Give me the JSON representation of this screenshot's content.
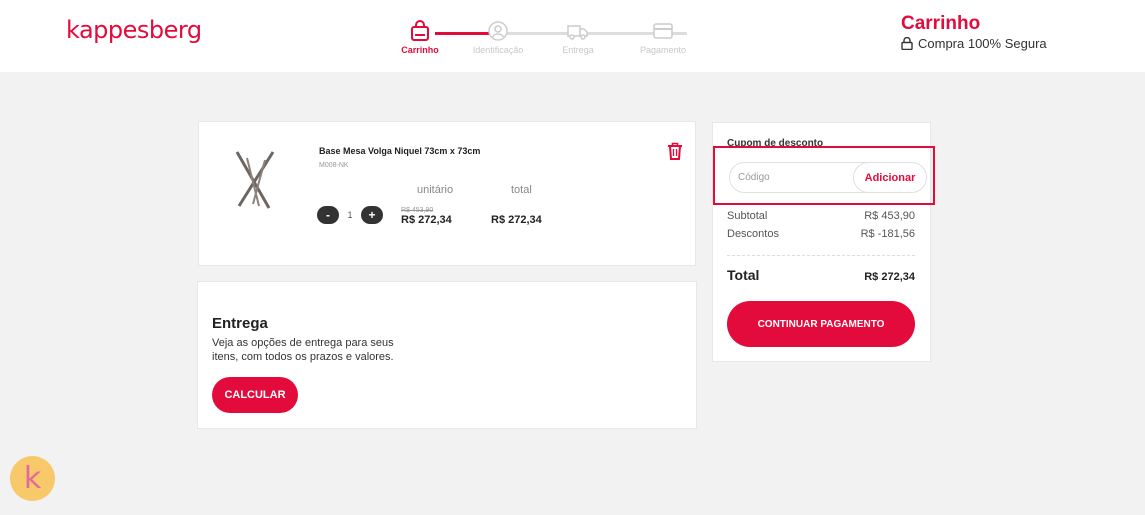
{
  "header": {
    "logo": "kappesberg",
    "title": "Carrinho",
    "secure_text": "Compra 100% Segura"
  },
  "steps": [
    {
      "label": "Carrinho",
      "icon": "bag-icon",
      "active": true
    },
    {
      "label": "Identificação",
      "icon": "user-icon",
      "active": false
    },
    {
      "label": "Entrega",
      "icon": "truck-icon",
      "active": false
    },
    {
      "label": "Pagamento",
      "icon": "card-icon",
      "active": false
    }
  ],
  "product": {
    "name": "Base Mesa Volga Niquel 73cm x 73cm",
    "sku": "M008-NK",
    "col_unit": "unitário",
    "col_total": "total",
    "qty": "1",
    "minus": "-",
    "plus": "+",
    "old_price": "R$ 453,90",
    "unit_price": "R$ 272,34",
    "total_price": "R$ 272,34"
  },
  "entrega": {
    "title": "Entrega",
    "description": "Veja as opções de entrega para seus itens, com todos os prazos e valores.",
    "button": "CALCULAR"
  },
  "summary": {
    "coupon_label": "Cupom de desconto",
    "coupon_placeholder": "Código",
    "coupon_button": "Adicionar",
    "subtotal_label": "Subtotal",
    "subtotal_value": "R$ 453,90",
    "discount_label": "Descontos",
    "discount_value": "R$ -181,56",
    "total_label": "Total",
    "total_value": "R$ 272,34",
    "continue_button": "CONTINUAR PAGAMENTO"
  },
  "chat": {
    "letter": "k"
  },
  "colors": {
    "accent": "#e30b3c",
    "badge": "#f7c96b"
  }
}
